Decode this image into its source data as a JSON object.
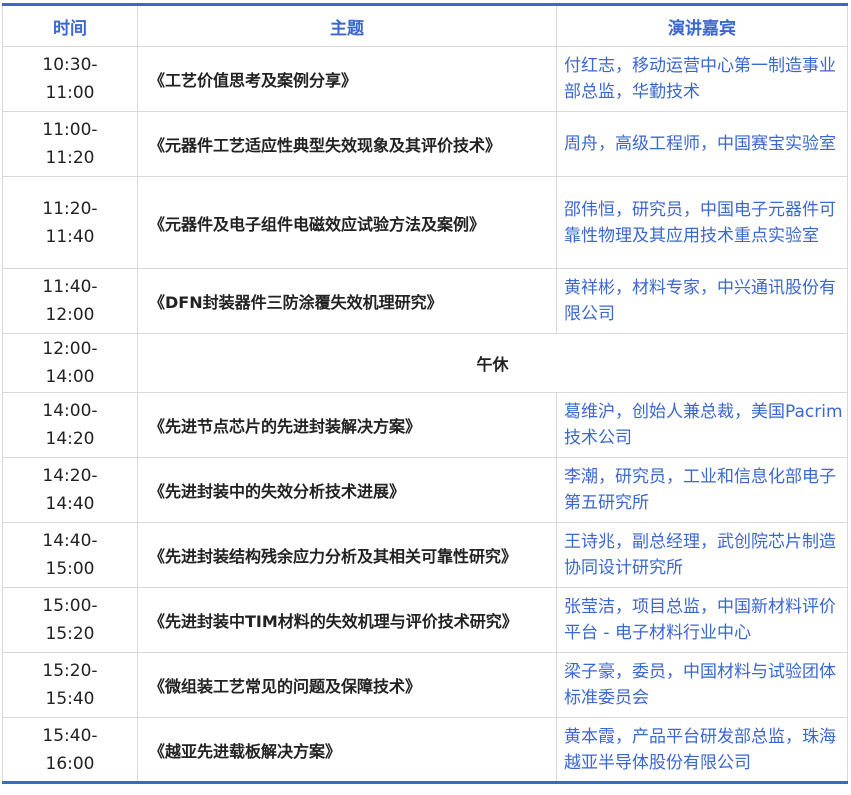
{
  "header": {
    "time": "时间",
    "topic": "主题",
    "speaker": "演讲嘉宾"
  },
  "rows": [
    {
      "start": "10:30-",
      "end": "11:00",
      "topic": "《工艺价值思考及案例分享》",
      "speaker": "付红志，移动运营中心第一制造事业部总监，华勤技术"
    },
    {
      "start": "11:00-",
      "end": "11:20",
      "topic": "《元器件工艺适应性典型失效现象及其评价技术》",
      "speaker": "周舟，高级工程师，中国赛宝实验室"
    },
    {
      "start": "11:20-",
      "end": "11:40",
      "topic": "《元器件及电子组件电磁效应试验方法及案例》",
      "speaker": "邵伟恒，研究员，中国电子元器件可靠性物理及其应用技术重点实验室"
    },
    {
      "start": "11:40-",
      "end": "12:00",
      "topic": "《DFN封装器件三防涂覆失效机理研究》",
      "speaker": "黄祥彬，材料专家，中兴通讯股份有限公司"
    },
    {
      "start": "12:00-",
      "end": "14:00",
      "topic": "午休",
      "speaker": ""
    },
    {
      "start": "14:00-",
      "end": "14:20",
      "topic": "《先进节点芯片的先进封装解决方案》",
      "speaker": "葛维沪，创始人兼总裁，美国Pacrim技术公司"
    },
    {
      "start": "14:20-",
      "end": "14:40",
      "topic": "《先进封装中的失效分析技术进展》",
      "speaker": "李潮，研究员，工业和信息化部电子第五研究所"
    },
    {
      "start": "14:40-",
      "end": "15:00",
      "topic": "《先进封装结构残余应力分析及其相关可靠性研究》",
      "speaker": "王诗兆，副总经理，武创院芯片制造协同设计研究所"
    },
    {
      "start": "15:00-",
      "end": "15:20",
      "topic": "《先进封装中TIM材料的失效机理与评价技术研究》",
      "speaker": "张莹洁，项目总监，中国新材料评价平台 - 电子材料行业中心"
    },
    {
      "start": "15:20-",
      "end": "15:40",
      "topic": "《微组装工艺常见的问题及保障技术》",
      "speaker": "梁子豪，委员，中国材料与试验团体标准委员会"
    },
    {
      "start": "15:40-",
      "end": "16:00",
      "topic": "《越亚先进载板解决方案》",
      "speaker": "黄本霞，产品平台研发部总监，珠海越亚半导体股份有限公司"
    }
  ]
}
